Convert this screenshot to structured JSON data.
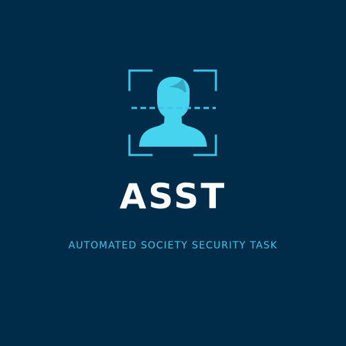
{
  "brand": {
    "name": "ASST",
    "tagline": "AUTOMATED SOCIETY SECURITY TASK"
  },
  "colors": {
    "background": "#002c4a",
    "accent": "#3fc6e6",
    "face_fill": "#45d3ee",
    "text": "#ffffff"
  },
  "icons": {
    "logo": "face-scan-icon"
  }
}
